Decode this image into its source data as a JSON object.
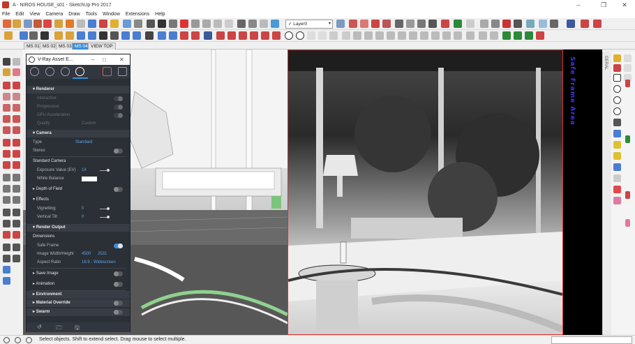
{
  "window": {
    "title": "A - NIROS HOUSE_s01 - SketchUp Pro 2017",
    "minimize": "–",
    "maximize": "❐",
    "close": "✕"
  },
  "menu": [
    "File",
    "Edit",
    "View",
    "Camera",
    "Draw",
    "Tools",
    "Window",
    "Extensions",
    "Help"
  ],
  "layer": {
    "check": "✓",
    "name": "Layer0",
    "chevron": "▾"
  },
  "scenes": [
    "MS 01",
    "MS 02",
    "MS 03",
    "MS 04",
    "VIEW TOP"
  ],
  "active_scene": "MS 04",
  "right_tab": "GERAL",
  "safe_frame_text": "Safe Frame Area",
  "vray_panel": {
    "title": "V-Ray Asset E...",
    "minimize": "–",
    "maximize": "□",
    "close": "✕",
    "renderer": {
      "header": "Renderer",
      "interactive": "Interactive",
      "progressive": "Progressive",
      "gpu": "GPU Acceleration",
      "quality": "Quality",
      "quality_value": "Custom"
    },
    "camera": {
      "header": "Camera",
      "type_label": "Type",
      "type_value": "Standard",
      "stereo": "Stereo",
      "standard_camera": "Standard Camera",
      "exposure_label": "Exposure Value (EV)",
      "exposure_value": "14",
      "white_balance": "White Balance",
      "depth_of_field": "Depth of Field",
      "effects": "Effects",
      "vignetting_label": "Vignetting",
      "vignetting_value": "0",
      "vertical_tilt_label": "Vertical Tilt",
      "vertical_tilt_value": "0"
    },
    "render_output": {
      "header": "Render Output",
      "dimensions": "Dimensions",
      "safe_frame": "Safe Frame",
      "wh_label": "Image Width/Height",
      "width": "4500",
      "height": "2531",
      "aspect_label": "Aspect Ratio",
      "aspect_value": "16:9 - Widescreen"
    },
    "save_image": "Save Image",
    "animation": "Animation",
    "environment": "Environment",
    "material_override": "Material Override",
    "swarm": "Swarm",
    "footer_icons": [
      "↺",
      "🗁",
      "🖫"
    ]
  },
  "status": {
    "text": "Select objects. Shift to extend select. Drag mouse to select multiple.",
    "icons": [
      "geo-location-icon",
      "credits-icon",
      "user-icon"
    ]
  }
}
